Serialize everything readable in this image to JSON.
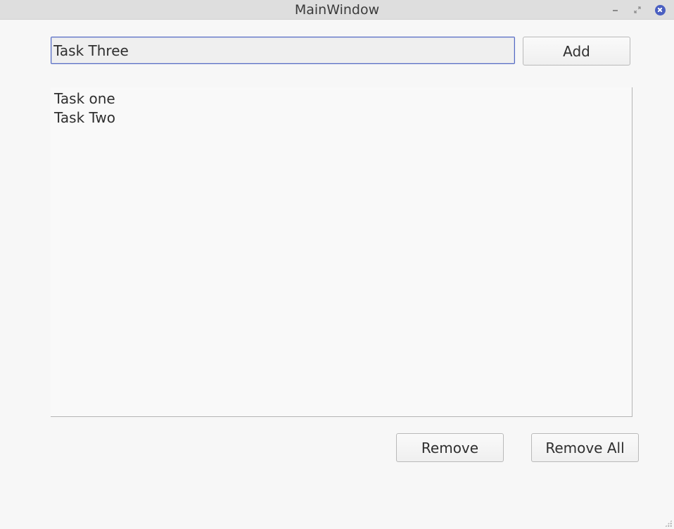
{
  "window": {
    "title": "MainWindow"
  },
  "input": {
    "value": "Task Three",
    "placeholder": ""
  },
  "buttons": {
    "add_label": "Add",
    "remove_label": "Remove",
    "remove_all_label": "Remove All"
  },
  "task_list": {
    "items": [
      "Task one",
      "Task Two"
    ]
  },
  "icons": {
    "minimize": "minimize-icon",
    "restore": "restore-icon",
    "close": "close-icon"
  },
  "colors": {
    "accent": "#4a5fc1",
    "focus_border": "#5369c4",
    "background": "#f7f7f7",
    "titlebar": "#dedede"
  }
}
